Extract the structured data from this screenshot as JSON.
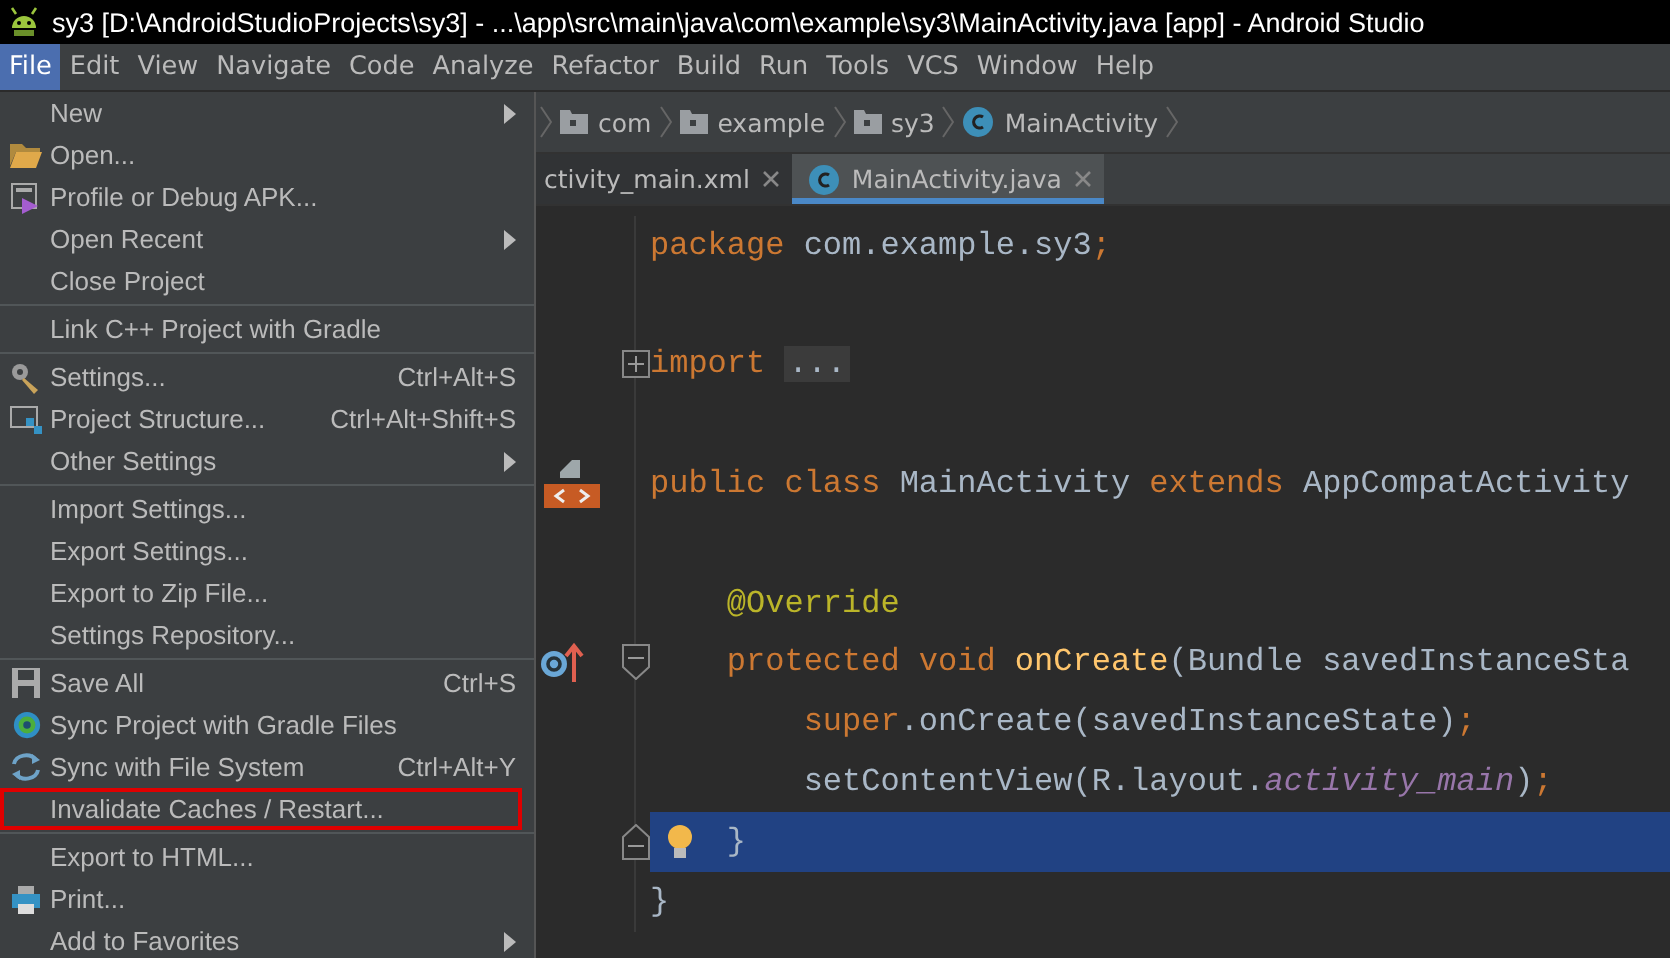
{
  "window": {
    "title": "sy3 [D:\\AndroidStudioProjects\\sy3] - ...\\app\\src\\main\\java\\com\\example\\sy3\\MainActivity.java [app] - Android Studio"
  },
  "menubar": [
    {
      "label": "File",
      "selected": true
    },
    {
      "label": "Edit",
      "selected": false
    },
    {
      "label": "View",
      "selected": false
    },
    {
      "label": "Navigate",
      "selected": false
    },
    {
      "label": "Code",
      "selected": false
    },
    {
      "label": "Analyze",
      "selected": false
    },
    {
      "label": "Refactor",
      "selected": false
    },
    {
      "label": "Build",
      "selected": false
    },
    {
      "label": "Run",
      "selected": false
    },
    {
      "label": "Tools",
      "selected": false
    },
    {
      "label": "VCS",
      "selected": false
    },
    {
      "label": "Window",
      "selected": false
    },
    {
      "label": "Help",
      "selected": false
    }
  ],
  "file_menu": {
    "groups": [
      [
        {
          "label": "New",
          "submenu": true,
          "outlined": false
        },
        {
          "label": "Open...",
          "submenu": false,
          "outlined": false
        },
        {
          "label": "Profile or Debug APK...",
          "submenu": false,
          "outlined": false
        },
        {
          "label": "Open Recent",
          "submenu": true,
          "outlined": false
        },
        {
          "label": "Close Project",
          "submenu": false,
          "outlined": false
        }
      ],
      [
        {
          "label": "Link C++ Project with Gradle",
          "submenu": false,
          "outlined": false
        }
      ],
      [
        {
          "label": "Settings...",
          "shortcut": "Ctrl+Alt+S",
          "submenu": false,
          "outlined": false
        },
        {
          "label": "Project Structure...",
          "shortcut": "Ctrl+Alt+Shift+S",
          "submenu": false,
          "outlined": false
        },
        {
          "label": "Other Settings",
          "submenu": true,
          "outlined": false
        }
      ],
      [
        {
          "label": "Import Settings...",
          "submenu": false,
          "outlined": false
        },
        {
          "label": "Export Settings...",
          "submenu": false,
          "outlined": false
        },
        {
          "label": "Export to Zip File...",
          "submenu": false,
          "outlined": false
        },
        {
          "label": "Settings Repository...",
          "submenu": false,
          "outlined": false
        }
      ],
      [
        {
          "label": "Save All",
          "shortcut": "Ctrl+S",
          "submenu": false,
          "outlined": false
        },
        {
          "label": "Sync Project with Gradle Files",
          "submenu": false,
          "outlined": false
        },
        {
          "label": "Sync with File System",
          "shortcut": "Ctrl+Alt+Y",
          "submenu": false,
          "outlined": false
        },
        {
          "label": "Invalidate Caches / Restart...",
          "submenu": false,
          "outlined": true
        }
      ],
      [
        {
          "label": "Export to HTML...",
          "submenu": false,
          "outlined": false
        },
        {
          "label": "Print...",
          "submenu": false,
          "outlined": false
        },
        {
          "label": "Add to Favorites",
          "submenu": true,
          "outlined": false
        }
      ]
    ]
  },
  "breadcrumbs": [
    {
      "label": "com",
      "kind": "folder"
    },
    {
      "label": "example",
      "kind": "folder"
    },
    {
      "label": "sy3",
      "kind": "folder"
    },
    {
      "label": "MainActivity",
      "kind": "class"
    }
  ],
  "tabs": [
    {
      "label": "ctivity_main.xml",
      "kind": "xml",
      "selected": false
    },
    {
      "label": "MainActivity.java",
      "kind": "class",
      "selected": true
    }
  ],
  "editor": {
    "lines": [
      {
        "selected": false,
        "tokens": [
          {
            "kind": "keyword",
            "text": "package"
          },
          {
            "kind": "plain",
            "text": " com.example.sy3"
          },
          {
            "kind": "keyword",
            "text": ";"
          }
        ]
      },
      {
        "selected": false
      },
      {
        "selected": false,
        "fold": {
          "kind": "expand"
        },
        "tokens": [
          {
            "kind": "keyword",
            "text": "import"
          },
          {
            "kind": "folded",
            "text": "..."
          }
        ]
      },
      {
        "selected": false
      },
      {
        "selected": false,
        "marker": {
          "kind": "layout"
        },
        "tokens": [
          {
            "kind": "keyword",
            "text": "public class"
          },
          {
            "kind": "plain",
            "text": " MainActivity "
          },
          {
            "kind": "keyword",
            "text": "extends"
          },
          {
            "kind": "plain",
            "text": " AppCompatActivity"
          }
        ]
      },
      {
        "selected": false
      },
      {
        "selected": false,
        "tokens": [
          {
            "kind": "annotation",
            "text": "    @Override"
          }
        ]
      },
      {
        "selected": false,
        "marker": {
          "kind": "override"
        },
        "fold": {
          "kind": "start"
        },
        "tokens": [
          {
            "kind": "keyword",
            "text": "    protected void"
          },
          {
            "kind": "method",
            "text": " onCreate"
          },
          {
            "kind": "plain",
            "text": "(Bundle savedInstanceSta"
          }
        ]
      },
      {
        "selected": false,
        "tokens": [
          {
            "kind": "keyword",
            "text": "        super"
          },
          {
            "kind": "plain",
            "text": ".onCreate(savedInstanceState)"
          },
          {
            "kind": "keyword",
            "text": ";"
          }
        ]
      },
      {
        "selected": false,
        "tokens": [
          {
            "kind": "plain",
            "text": "        setContentView(R.layout."
          },
          {
            "kind": "field",
            "text": "activity_main"
          },
          {
            "kind": "plain",
            "text": ")"
          },
          {
            "kind": "keyword",
            "text": ";"
          }
        ]
      },
      {
        "selected": true,
        "marker": {
          "kind": "bulb"
        },
        "fold": {
          "kind": "end"
        },
        "tokens": [
          {
            "kind": "plain",
            "text": "}"
          }
        ]
      },
      {
        "selected": false,
        "tokens": [
          {
            "kind": "plain",
            "text": "}"
          }
        ]
      }
    ]
  }
}
